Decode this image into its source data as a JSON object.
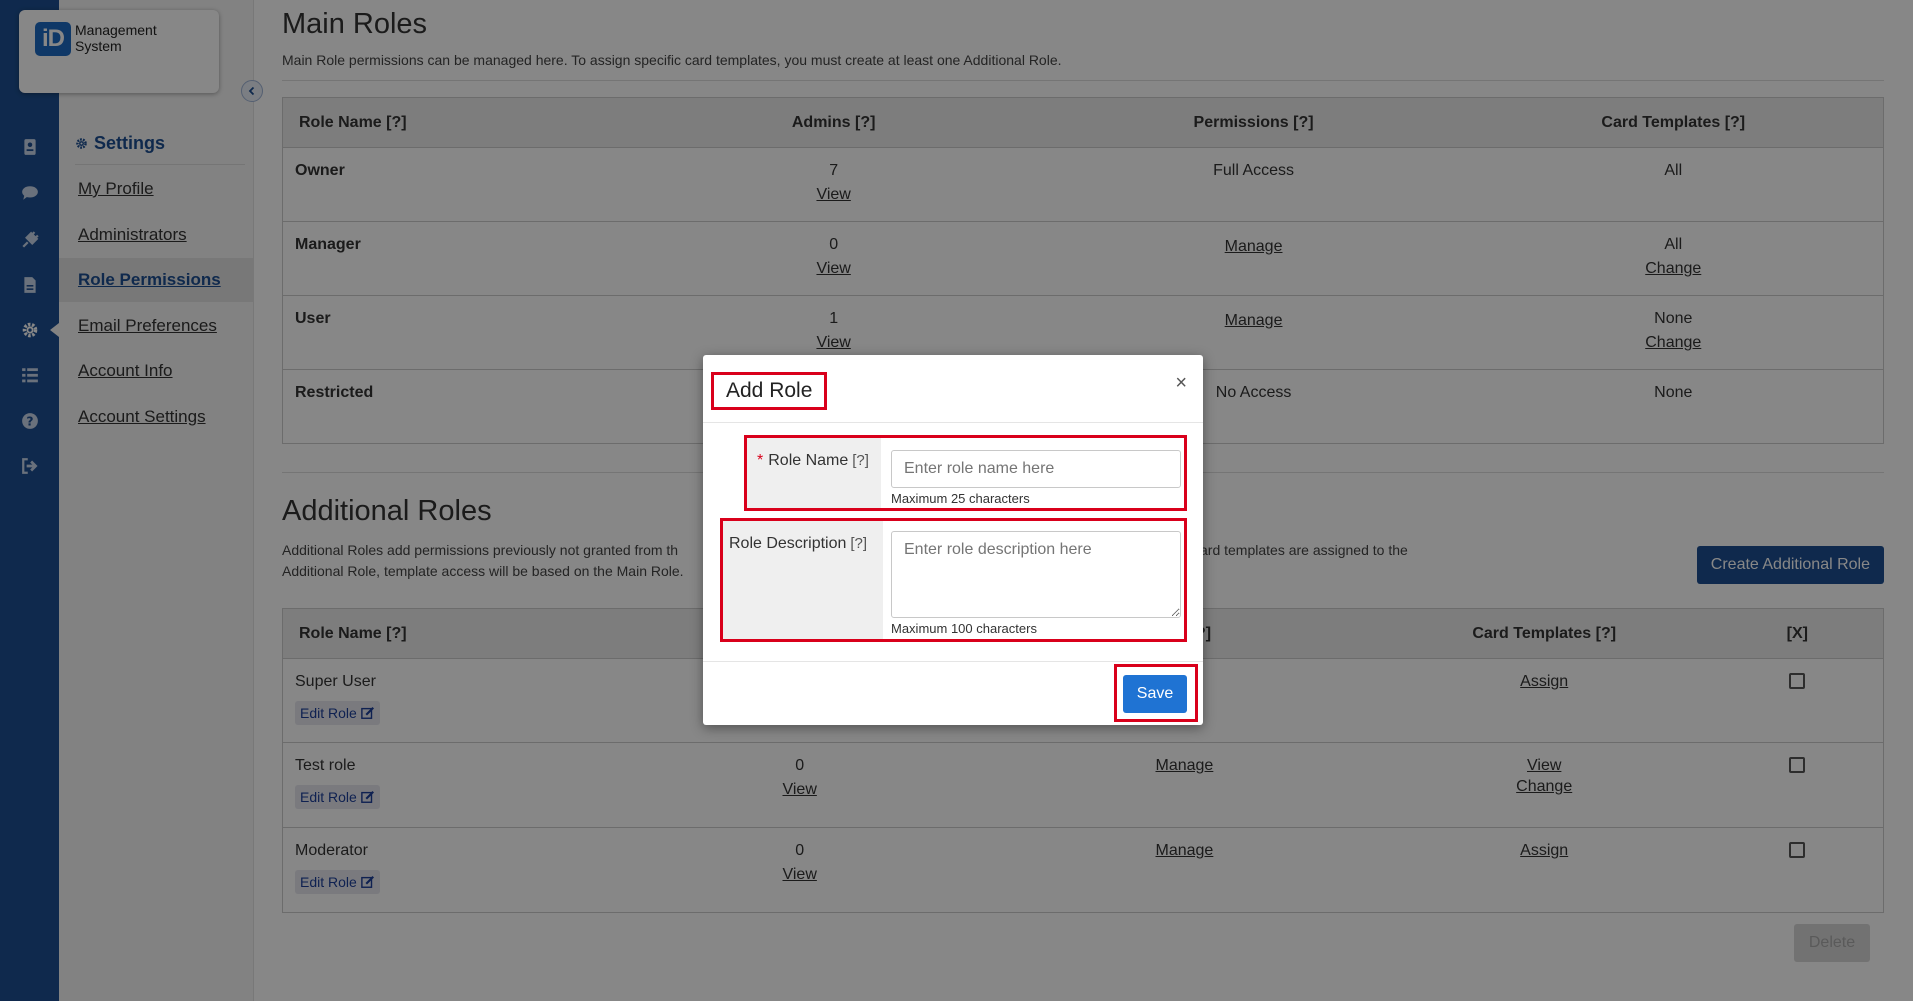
{
  "app": {
    "logo_mark": "iD",
    "logo_text": "Management System"
  },
  "rail_icons": [
    "badge-icon",
    "chat-icon",
    "plug-icon",
    "document-icon",
    "gear-icon",
    "list-icon",
    "help-icon",
    "sign-out-icon"
  ],
  "sidebar": {
    "heading": "Settings",
    "items": [
      {
        "label": "My Profile",
        "active": false
      },
      {
        "label": "Administrators",
        "active": false
      },
      {
        "label": "Role Permissions",
        "active": true
      },
      {
        "label": "Email Preferences",
        "active": false
      },
      {
        "label": "Account Info",
        "active": false
      },
      {
        "label": "Account Settings",
        "active": false
      }
    ]
  },
  "main_roles": {
    "title": "Main Roles",
    "description": "Main Role permissions can be managed here. To assign specific card templates, you must create at least one Additional Role.",
    "headers": [
      "Role Name [?]",
      "Admins [?]",
      "Permissions [?]",
      "Card Templates [?]"
    ],
    "rows": [
      {
        "name": "Owner",
        "admins": "7",
        "admins_link": "View",
        "permissions": "Full Access",
        "permissions_link": false,
        "templates": "All",
        "templates_link": ""
      },
      {
        "name": "Manager",
        "admins": "0",
        "admins_link": "View",
        "permissions": "Manage",
        "permissions_link": true,
        "templates": "All",
        "templates_link": "Change"
      },
      {
        "name": "User",
        "admins": "1",
        "admins_link": "View",
        "permissions": "Manage",
        "permissions_link": true,
        "templates": "None",
        "templates_link": "Change"
      },
      {
        "name": "Restricted",
        "admins": "",
        "admins_link": "",
        "permissions": "No Access",
        "permissions_link": false,
        "templates": "None",
        "templates_link": ""
      }
    ]
  },
  "additional_roles": {
    "title": "Additional Roles",
    "description_left_1": "Additional Roles add permissions previously not granted from th",
    "description_right_1": "ard templates are assigned to the",
    "description_left_2": "Additional Role, template access will be based on the Main Role.",
    "create_button": "Create Additional Role",
    "headers": [
      "Role Name [?]",
      "",
      "ons [?]",
      "Card Templates [?]",
      "[X]"
    ],
    "edit_label": "Edit Role",
    "rows": [
      {
        "name": "Super User",
        "admins": "",
        "admins_link": "",
        "permissions": "age",
        "templates": "Assign",
        "templates_link": ""
      },
      {
        "name": "Test role",
        "admins": "0",
        "admins_link": "View",
        "permissions": "Manage",
        "templates": "View",
        "templates_link": "Change"
      },
      {
        "name": "Moderator",
        "admins": "0",
        "admins_link": "View",
        "permissions": "Manage",
        "templates": "Assign",
        "templates_link": ""
      }
    ],
    "delete_button": "Delete"
  },
  "modal": {
    "title": "Add Role",
    "close": "×",
    "role_name_label": "Role Name",
    "role_name_help": "[?]",
    "role_name_placeholder": "Enter role name here",
    "role_name_hint": "Maximum 25 characters",
    "role_desc_label": "Role Description",
    "role_desc_help": "[?]",
    "role_desc_placeholder": "Enter role description here",
    "role_desc_hint": "Maximum 100 characters",
    "save": "Save"
  },
  "colors": {
    "rail": "#1d4f91",
    "highlight": "#d9001b",
    "save_button": "#1f73d3"
  }
}
